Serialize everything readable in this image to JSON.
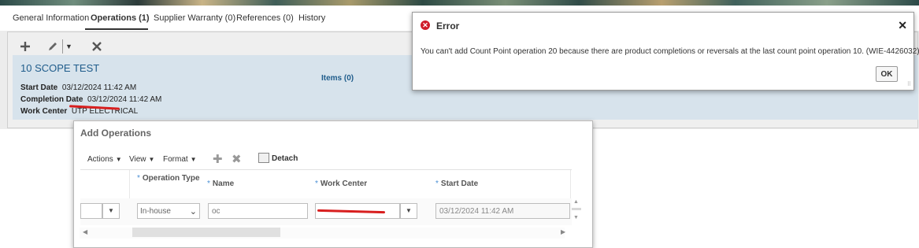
{
  "tabs": [
    {
      "label": "General Information"
    },
    {
      "label": "Operations (1)"
    },
    {
      "label": "Supplier Warranty (0)"
    },
    {
      "label": "References (0)"
    },
    {
      "label": "History"
    }
  ],
  "toolbar": {
    "add_icon": "plus-icon",
    "edit_icon": "pencil-icon",
    "delete_icon": "close-icon"
  },
  "summary": {
    "title": "10 SCOPE TEST",
    "start_label": "Start Date",
    "start_value": "03/12/2024 11:42 AM",
    "completion_label": "Completion Date",
    "completion_value": "03/12/2024 11:42 AM",
    "workcenter_label": "Work Center",
    "workcenter_value": "UTP ELECTRICAL",
    "items_link": "Items (0)"
  },
  "add_operations": {
    "title": "Add Operations",
    "toolbar": {
      "actions": "Actions",
      "view": "View",
      "format": "Format",
      "detach": "Detach"
    },
    "columns": {
      "operation_type": "Operation Type",
      "name": "Name",
      "work_center": "Work Center",
      "start_date": "Start Date"
    },
    "row": {
      "operation_type": "In-house",
      "name": "oc",
      "work_center": "",
      "start_date": "03/12/2024 11:42 AM"
    }
  },
  "error_dialog": {
    "title": "Error",
    "message": "You can't add Count Point operation 20 because there are product completions or reversals at the last count point operation 10. (WIE-4426032)",
    "ok_label": "OK"
  },
  "colors": {
    "accent": "#1f5c8b",
    "error": "#cf1c2a",
    "summary_bg": "#d7e3ec",
    "redaction": "#d81f1f"
  }
}
